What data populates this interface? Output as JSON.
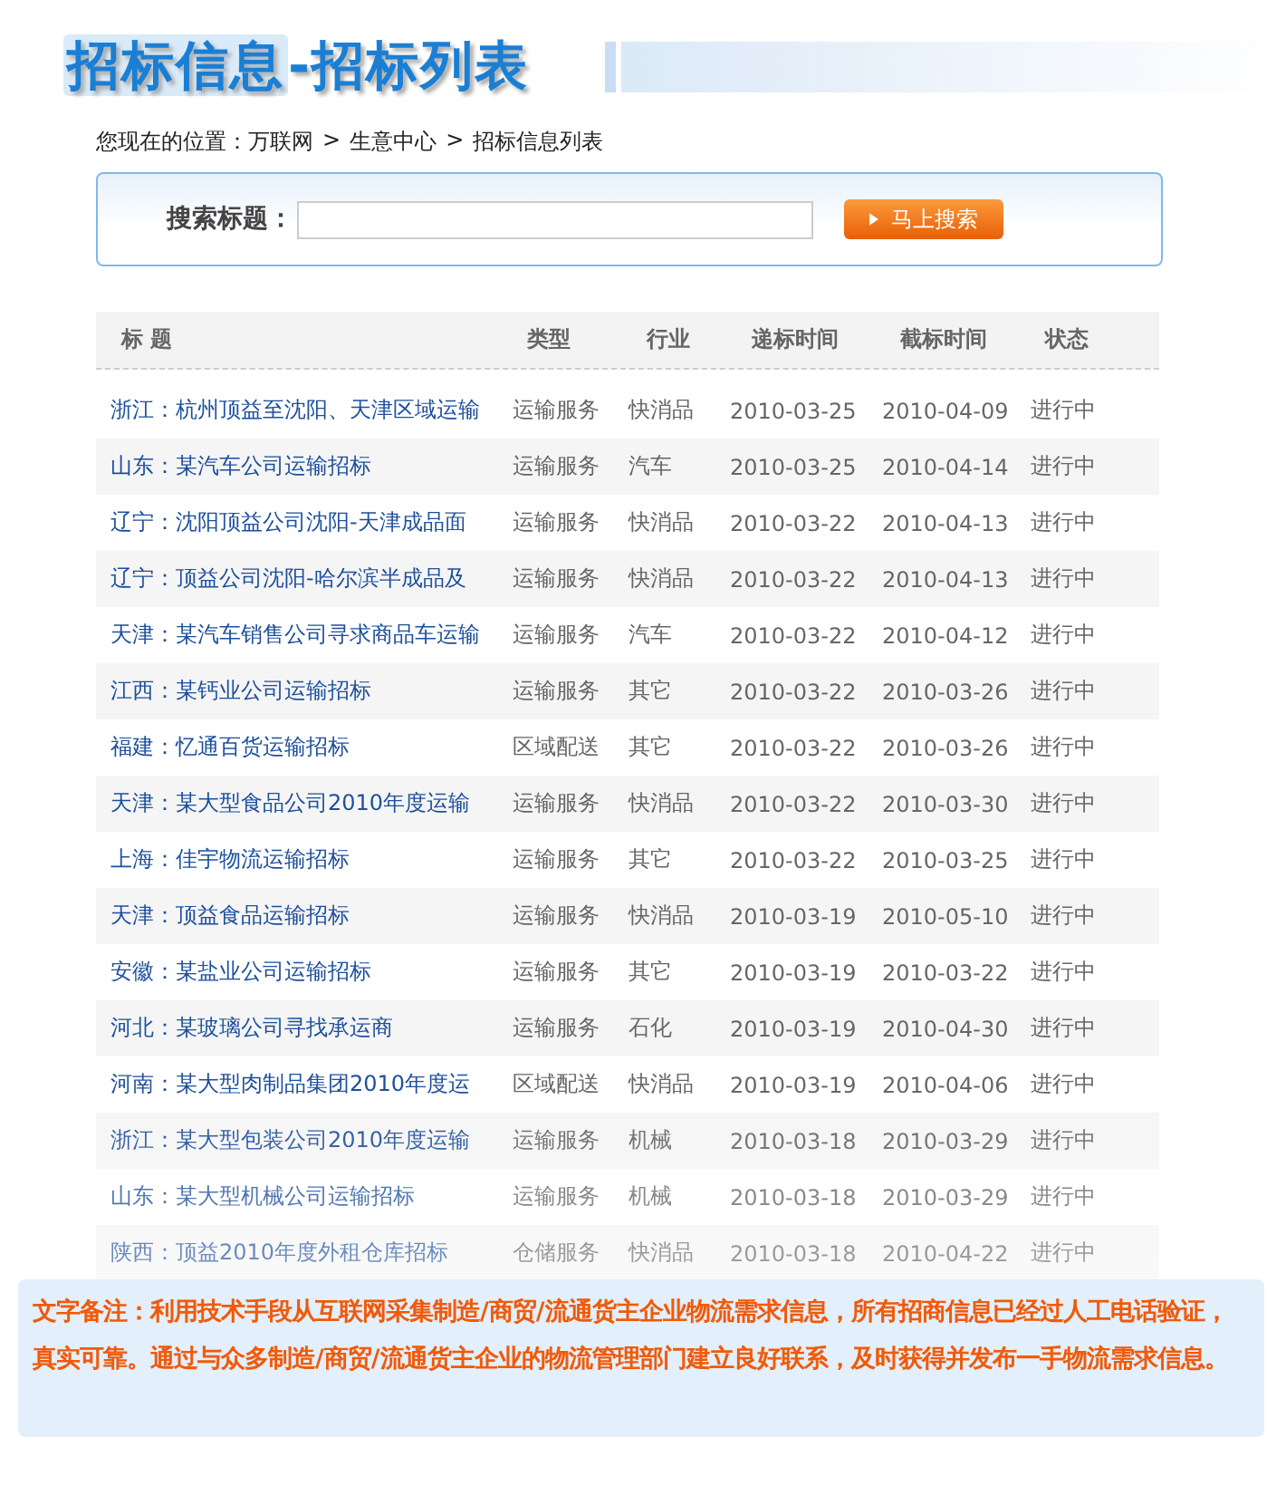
{
  "page_title": {
    "highlighted": "招标信息",
    "rest": "-招标列表"
  },
  "breadcrumb": [
    {
      "kind": "label",
      "text": "您现在的位置："
    },
    {
      "kind": "link",
      "text": "万联网"
    },
    {
      "kind": "separator",
      "text": ">"
    },
    {
      "kind": "link",
      "text": "生意中心"
    },
    {
      "kind": "separator",
      "text": ">"
    },
    {
      "kind": "link",
      "text": "招标信息列表"
    }
  ],
  "search": {
    "label": "搜索标题：",
    "button": "马上搜索"
  },
  "table": {
    "columns": [
      "标 题",
      "类型",
      "行业",
      "递标时间",
      "截标时间",
      "状态"
    ],
    "rows": [
      [
        "浙江：杭州顶益至沈阳、天津区域运输",
        "运输服务",
        "快消品",
        "2010-03-25",
        "2010-04-09",
        "进行中"
      ],
      [
        "山东：某汽车公司运输招标",
        "运输服务",
        "汽车",
        "2010-03-25",
        "2010-04-14",
        "进行中"
      ],
      [
        "辽宁：沈阳顶益公司沈阳-天津成品面",
        "运输服务",
        "快消品",
        "2010-03-22",
        "2010-04-13",
        "进行中"
      ],
      [
        "辽宁：顶益公司沈阳-哈尔滨半成品及",
        "运输服务",
        "快消品",
        "2010-03-22",
        "2010-04-13",
        "进行中"
      ],
      [
        "天津：某汽车销售公司寻求商品车运输",
        "运输服务",
        "汽车",
        "2010-03-22",
        "2010-04-12",
        "进行中"
      ],
      [
        "江西：某钙业公司运输招标",
        "运输服务",
        "其它",
        "2010-03-22",
        "2010-03-26",
        "进行中"
      ],
      [
        "福建：忆通百货运输招标",
        "区域配送",
        "其它",
        "2010-03-22",
        "2010-03-26",
        "进行中"
      ],
      [
        "天津：某大型食品公司2010年度运输",
        "运输服务",
        "快消品",
        "2010-03-22",
        "2010-03-30",
        "进行中"
      ],
      [
        "上海：佳宇物流运输招标",
        "运输服务",
        "其它",
        "2010-03-22",
        "2010-03-25",
        "进行中"
      ],
      [
        "天津：顶益食品运输招标",
        "运输服务",
        "快消品",
        "2010-03-19",
        "2010-05-10",
        "进行中"
      ],
      [
        "安徽：某盐业公司运输招标",
        "运输服务",
        "其它",
        "2010-03-19",
        "2010-03-22",
        "进行中"
      ],
      [
        "河北：某玻璃公司寻找承运商",
        "运输服务",
        "石化",
        "2010-03-19",
        "2010-04-30",
        "进行中"
      ],
      [
        "河南：某大型肉制品集团2010年度运",
        "区域配送",
        "快消品",
        "2010-03-19",
        "2010-04-06",
        "进行中"
      ],
      [
        "浙江：某大型包装公司2010年度运输",
        "运输服务",
        "机械",
        "2010-03-18",
        "2010-03-29",
        "进行中"
      ],
      [
        "山东：某大型机械公司运输招标",
        "运输服务",
        "机械",
        "2010-03-18",
        "2010-03-29",
        "进行中"
      ],
      [
        "陕西：顶益2010年度外租仓库招标",
        "仓储服务",
        "快消品",
        "2010-03-18",
        "2010-04-22",
        "进行中"
      ]
    ]
  },
  "note": "文字备注：利用技术手段从互联网采集制造/商贸/流通货主企业物流需求信息，所有招商信息已经过人工电话验证，真实可靠。通过与众多制造/商贸/流通货主企业的物流管理部门建立良好联系，及时获得并发布一手物流需求信息。"
}
